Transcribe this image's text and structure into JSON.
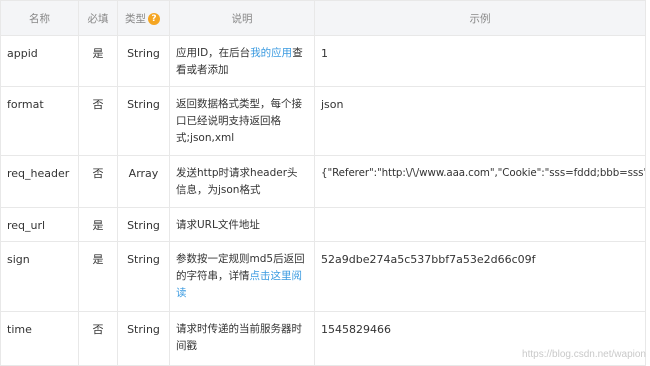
{
  "headers": {
    "name": "名称",
    "required": "必填",
    "type": "类型",
    "description": "说明",
    "example": "示例"
  },
  "rows": [
    {
      "name": "appid",
      "required": "是",
      "type": "String",
      "desc_before": "应用ID，在后台",
      "desc_link": "我的应用",
      "desc_after": "查看或者添加",
      "example": "1"
    },
    {
      "name": "format",
      "required": "否",
      "type": "String",
      "desc_before": "返回数据格式类型，每个接口已经说明支持返回格式;json,xml",
      "desc_link": "",
      "desc_after": "",
      "example": "json"
    },
    {
      "name": "req_header",
      "required": "否",
      "type": "Array",
      "desc_before": "发送http时请求header头信息，为json格式",
      "desc_link": "",
      "desc_after": "",
      "example": "{\"Referer\":\"http:\\/\\/www.aaa.com\",\"Cookie\":\"sss=fddd;bbb=sss\"}"
    },
    {
      "name": "req_url",
      "required": "是",
      "type": "String",
      "desc_before": "请求URL文件地址",
      "desc_link": "",
      "desc_after": "",
      "example": ""
    },
    {
      "name": "sign",
      "required": "是",
      "type": "String",
      "desc_before": "参数按一定规则md5后返回的字符串，详情",
      "desc_link": "点击这里阅读",
      "desc_after": "",
      "example": "52a9dbe274a5c537bbf7a53e2d66c09f"
    },
    {
      "name": "time",
      "required": "否",
      "type": "String",
      "desc_before": "请求时传递的当前服务器时间戳",
      "desc_link": "",
      "desc_after": "",
      "example": "1545829466"
    }
  ],
  "watermark": "https://blog.csdn.net/wapion",
  "colors": {
    "link": "#3a9ae0",
    "header_bg": "#f4f5f7",
    "help_icon": "#f5a623"
  },
  "icons": {
    "type_help": "question-circle-icon"
  }
}
